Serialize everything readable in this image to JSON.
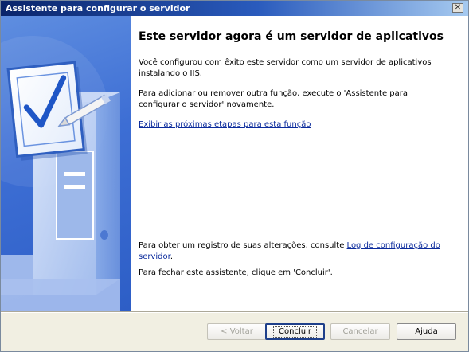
{
  "window": {
    "title": "Assistente para configurar o servidor",
    "close_glyph": "✕"
  },
  "sidebar": {
    "illustration": "server-with-checkmark-document-and-pen",
    "check_glyph": "✓"
  },
  "content": {
    "heading": "Este servidor agora é um servidor de aplicativos",
    "para1": "Você configurou com êxito este servidor como um servidor de aplicativos instalando o IIS.",
    "para2": "Para adicionar ou remover outra função, execute o 'Assistente para configurar o servidor' novamente.",
    "next_steps_link": "Exibir as próximas etapas para esta função",
    "log_text": "Para obter um registro de suas alterações, consulte ",
    "log_link": "Log de configuração do servidor",
    "log_end": ".",
    "close_text": "Para fechar este assistente, clique em 'Concluir'."
  },
  "buttons": {
    "back": "< Voltar",
    "finish": "Concluir",
    "cancel": "Cancelar",
    "help": "Ajuda"
  },
  "colors": {
    "titlebar_start": "#0a246a",
    "titlebar_end": "#a6caf0",
    "sidebar_blue": "#3d6ed4",
    "link": "#0a2a9c",
    "footer_bg": "#f1efe2"
  }
}
